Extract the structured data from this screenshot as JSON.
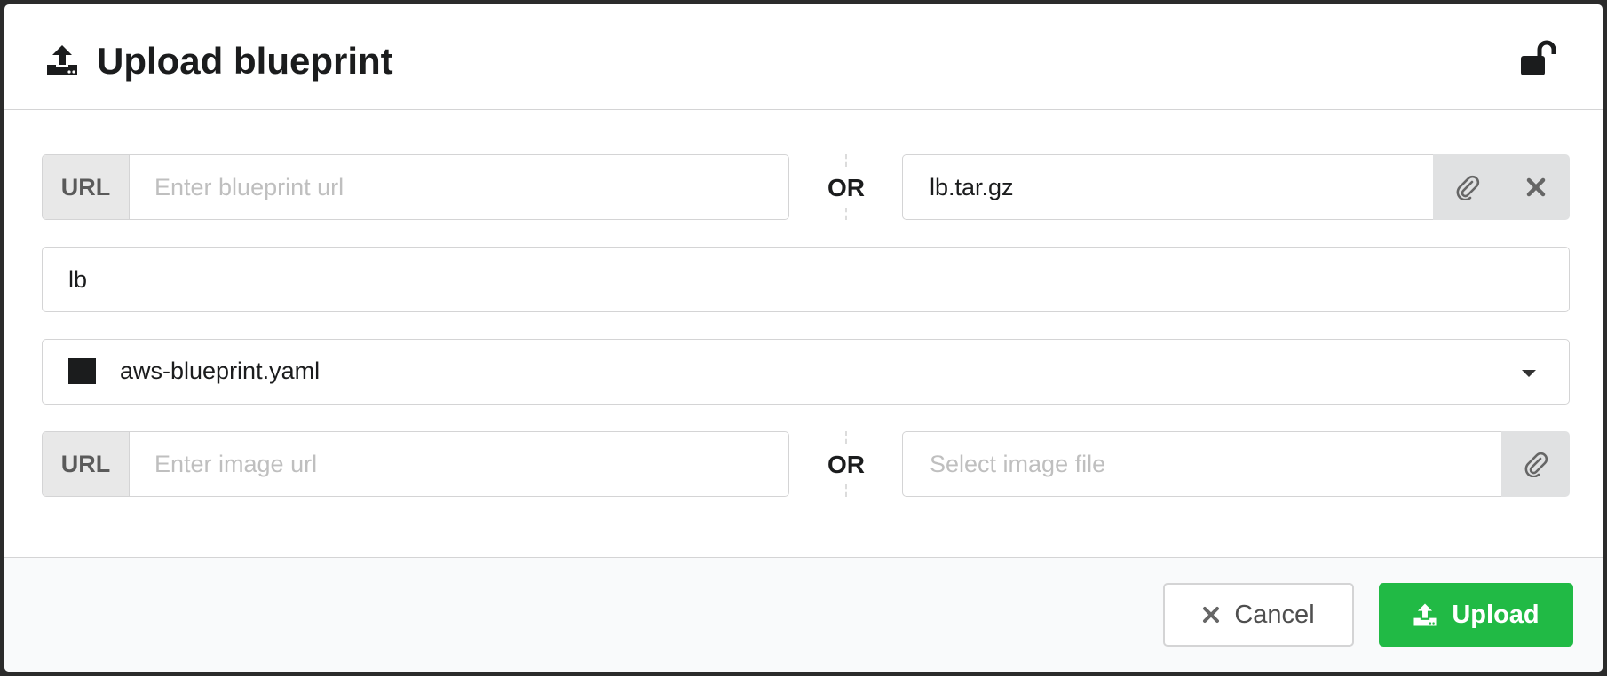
{
  "modal": {
    "title": "Upload blueprint",
    "title_icon": "upload-icon",
    "lock_icon": "unlock-icon"
  },
  "blueprint_url": {
    "label": "URL",
    "placeholder": "Enter blueprint url",
    "value": ""
  },
  "separator_text": "OR",
  "blueprint_file": {
    "value": "lb.tar.gz",
    "attach_icon": "paperclip-icon",
    "clear_icon": "close-icon"
  },
  "blueprint_name": {
    "value": "lb"
  },
  "blueprint_yaml": {
    "value": "aws-blueprint.yaml",
    "caret_icon": "caret-down-icon"
  },
  "image_url": {
    "label": "URL",
    "placeholder": "Enter image url",
    "value": ""
  },
  "image_file": {
    "placeholder": "Select image file",
    "attach_icon": "paperclip-icon"
  },
  "footer": {
    "cancel_label": "Cancel",
    "upload_label": "Upload"
  },
  "colors": {
    "primary_green": "#21ba45",
    "label_bg": "#e8e8e8",
    "button_bg": "#e0e1e2"
  }
}
